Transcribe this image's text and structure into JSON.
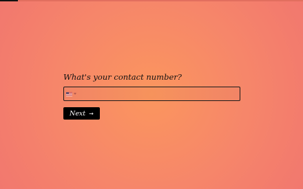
{
  "progress": {
    "fraction": 0.06
  },
  "question": {
    "text": "What's your contact number?"
  },
  "phone_field": {
    "value": "",
    "placeholder": "",
    "country_icon": "us-flag-icon"
  },
  "next_button": {
    "label": "Next",
    "icon": "arrow-right-icon",
    "glyph": "→"
  },
  "colors": {
    "background_center": "#fb965e",
    "background_edge": "#ef746f",
    "text": "#111111",
    "button_background": "#000000",
    "button_text": "#ffffff"
  }
}
